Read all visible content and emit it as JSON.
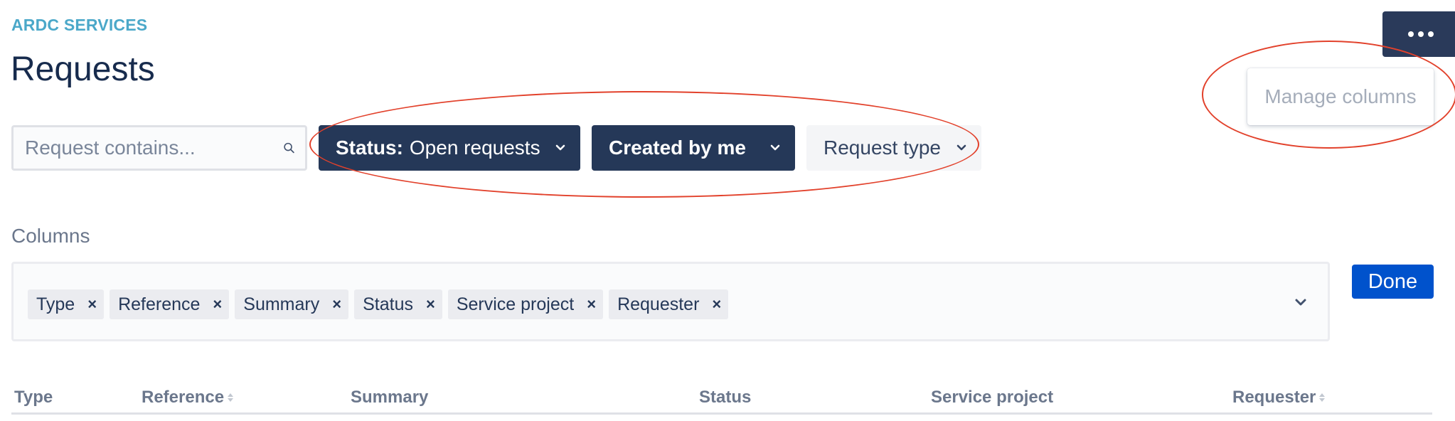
{
  "header": {
    "breadcrumb": "ARDC SERVICES",
    "title": "Requests"
  },
  "more_menu": {
    "button_icon": "more-horizontal-icon",
    "items": [
      {
        "label": "Manage columns",
        "disabled": true
      }
    ]
  },
  "filters": {
    "search_placeholder": "Request contains...",
    "search_icon": "search-icon",
    "status": {
      "prefix": "Status:",
      "value": "Open requests",
      "active": true
    },
    "created_by": {
      "label": "Created by me",
      "active": true
    },
    "request_type": {
      "label": "Request type",
      "active": false
    }
  },
  "columns_editor": {
    "label": "Columns",
    "chips": [
      "Type",
      "Reference",
      "Summary",
      "Status",
      "Service project",
      "Requester"
    ],
    "remove_glyph": "×",
    "done_label": "Done"
  },
  "table": {
    "headers": [
      {
        "label": "Type",
        "sortable": false
      },
      {
        "label": "Reference",
        "sortable": true
      },
      {
        "label": "Summary",
        "sortable": false
      },
      {
        "label": "Status",
        "sortable": false
      },
      {
        "label": "Service project",
        "sortable": false
      },
      {
        "label": "Requester",
        "sortable": true
      }
    ]
  },
  "colors": {
    "breadcrumb": "#4ba8c9",
    "title": "#172b4d",
    "dark_button": "#253858",
    "primary_button": "#0052cc",
    "annotation": "#e2412b"
  }
}
